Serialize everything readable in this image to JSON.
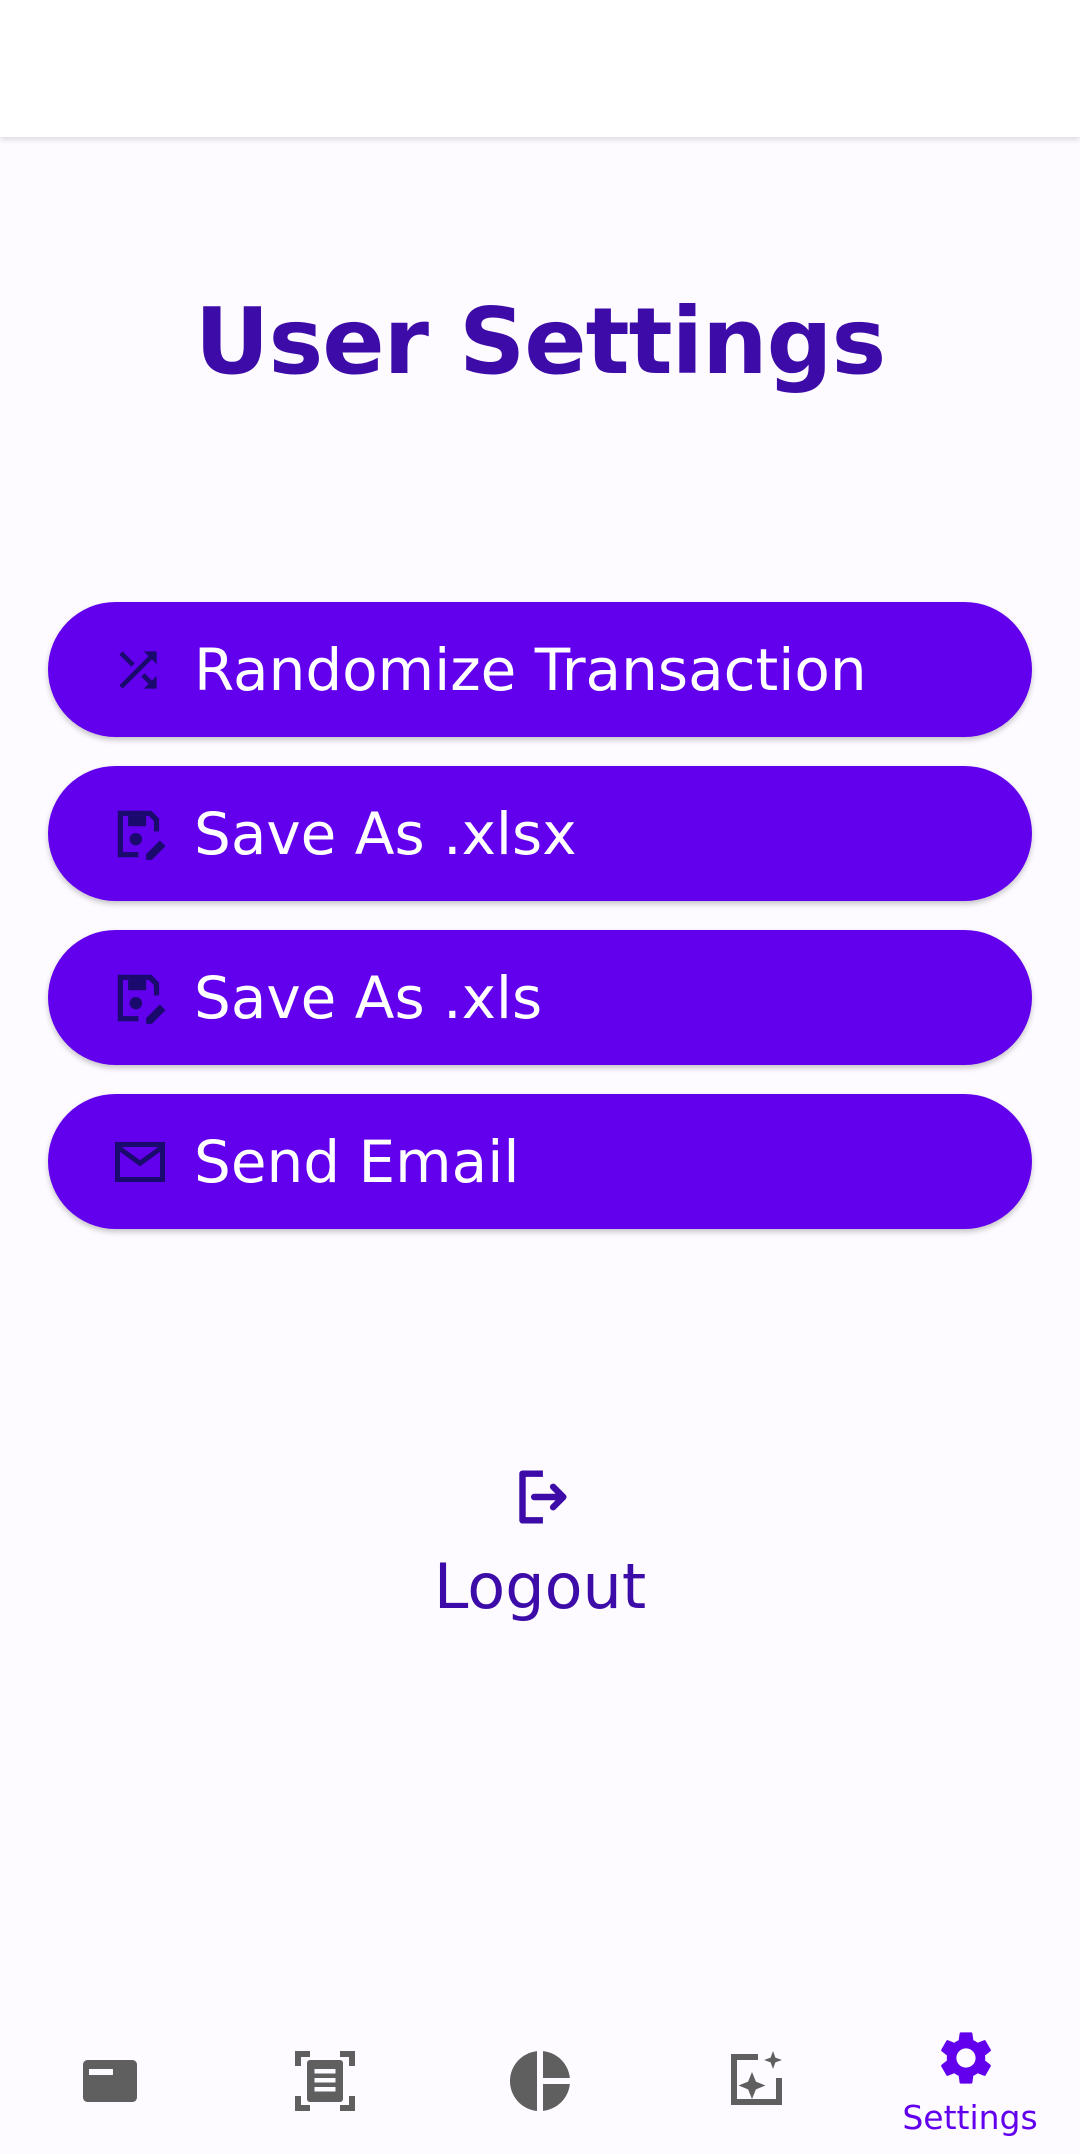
{
  "header": {
    "title": "User Settings"
  },
  "actions": [
    {
      "label": "Randomize Transaction",
      "icon": "shuffle-icon"
    },
    {
      "label": "Save As .xlsx",
      "icon": "save-edit-icon"
    },
    {
      "label": "Save As .xls",
      "icon": "save-edit-icon"
    },
    {
      "label": "Send Email",
      "icon": "mail-icon"
    }
  ],
  "logout": {
    "label": "Logout",
    "icon": "logout-icon"
  },
  "bottom_nav": {
    "items": [
      {
        "icon": "card-icon",
        "label": ""
      },
      {
        "icon": "document-scan-icon",
        "label": ""
      },
      {
        "icon": "pie-chart-icon",
        "label": ""
      },
      {
        "icon": "sparkle-image-icon",
        "label": ""
      },
      {
        "icon": "gear-icon",
        "label": "Settings",
        "selected": true
      }
    ]
  },
  "colors": {
    "accent": "#6200ee",
    "title": "#3d0ba8",
    "icon_dark": "#1a0a6e",
    "nav_inactive": "#5f5f5f"
  }
}
